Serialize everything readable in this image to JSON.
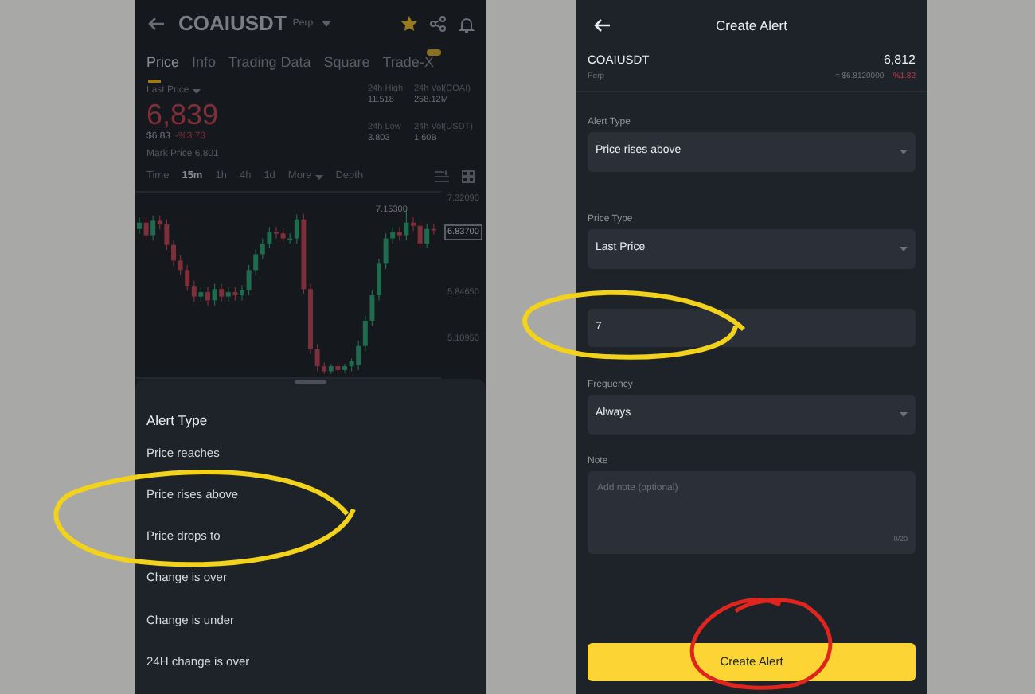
{
  "left_screen": {
    "header": {
      "symbol": "COAIUSDT",
      "contract": "Perp"
    },
    "tabs": [
      {
        "label": "Price",
        "selected": true
      },
      {
        "label": "Info",
        "selected": false
      },
      {
        "label": "Trading Data",
        "selected": false
      },
      {
        "label": "Square",
        "selected": false
      },
      {
        "label": "Trade-X",
        "selected": false
      }
    ],
    "ticker": {
      "price_label": "Last Price",
      "price": "6,839",
      "usd": "$6.83",
      "change": "-%3.73",
      "mark_price": "Mark Price 6.801"
    },
    "stats": [
      {
        "label": "24h High",
        "value": "11.518"
      },
      {
        "label": "24h Vol(COAI)",
        "value": "258.12M"
      },
      {
        "label": "24h Low",
        "value": "3.803"
      },
      {
        "label": "24h Vol(USDT)",
        "value": "1.60B"
      }
    ],
    "intervals": [
      {
        "label": "Time",
        "selected": false
      },
      {
        "label": "15m",
        "selected": true
      },
      {
        "label": "1h",
        "selected": false
      },
      {
        "label": "4h",
        "selected": false
      },
      {
        "label": "1d",
        "selected": false
      },
      {
        "label": "More",
        "selected": false
      },
      {
        "label": "Depth",
        "selected": false
      }
    ],
    "chart_data": {
      "type": "candlestick",
      "ohlc": [
        [
          6.85,
          7.03,
          6.77,
          6.95
        ],
        [
          6.95,
          7.03,
          6.67,
          6.75
        ],
        [
          6.75,
          7.06,
          6.67,
          6.98
        ],
        [
          6.98,
          7.06,
          6.84,
          6.92
        ],
        [
          6.92,
          7.0,
          6.52,
          6.6
        ],
        [
          6.6,
          6.68,
          6.27,
          6.35
        ],
        [
          6.35,
          6.43,
          6.12,
          6.2
        ],
        [
          6.2,
          6.28,
          5.87,
          5.95
        ],
        [
          5.95,
          6.03,
          5.7,
          5.78
        ],
        [
          5.78,
          5.93,
          5.7,
          5.85
        ],
        [
          5.85,
          5.93,
          5.64,
          5.72
        ],
        [
          5.72,
          5.98,
          5.64,
          5.9
        ],
        [
          5.9,
          5.98,
          5.7,
          5.78
        ],
        [
          5.78,
          5.93,
          5.7,
          5.85
        ],
        [
          5.85,
          5.93,
          5.72,
          5.8
        ],
        [
          5.8,
          5.96,
          5.72,
          5.88
        ],
        [
          5.88,
          6.28,
          5.8,
          6.2
        ],
        [
          6.2,
          6.53,
          6.12,
          6.45
        ],
        [
          6.45,
          6.7,
          6.37,
          6.62
        ],
        [
          6.62,
          6.88,
          6.54,
          6.8
        ],
        [
          6.8,
          6.88,
          6.7,
          6.78
        ],
        [
          6.78,
          6.86,
          6.62,
          6.7
        ],
        [
          6.7,
          6.78,
          6.62,
          6.7
        ],
        [
          6.7,
          7.08,
          6.62,
          7.0
        ],
        [
          7.0,
          7.08,
          5.82,
          5.9
        ],
        [
          5.9,
          5.98,
          4.87,
          4.95
        ],
        [
          4.95,
          5.03,
          4.6,
          4.68
        ],
        [
          4.68,
          4.74,
          4.56,
          4.6
        ],
        [
          4.6,
          4.72,
          4.56,
          4.68
        ],
        [
          4.68,
          4.74,
          4.58,
          4.62
        ],
        [
          4.62,
          4.72,
          4.57,
          4.68
        ],
        [
          4.68,
          4.8,
          4.6,
          4.76
        ],
        [
          4.7,
          5.08,
          4.62,
          5.0
        ],
        [
          5.0,
          5.48,
          4.92,
          5.4
        ],
        [
          5.4,
          5.88,
          5.32,
          5.8
        ],
        [
          5.8,
          6.38,
          5.72,
          6.3
        ],
        [
          6.3,
          6.78,
          6.22,
          6.7
        ],
        [
          6.7,
          6.88,
          6.62,
          6.8
        ],
        [
          6.8,
          6.88,
          6.67,
          6.75
        ],
        [
          6.75,
          7.153,
          6.67,
          6.95
        ],
        [
          6.95,
          7.03,
          6.82,
          6.9
        ],
        [
          6.9,
          6.98,
          6.54,
          6.62
        ],
        [
          6.62,
          6.93,
          6.54,
          6.85
        ],
        [
          6.85,
          6.93,
          6.76,
          6.84
        ]
      ],
      "yticks": [
        {
          "value": 7.3209,
          "label": "7.32090"
        },
        {
          "value": 5.8465,
          "label": "5.84650"
        },
        {
          "value": 5.1095,
          "label": "5.10950"
        }
      ],
      "ylim": [
        4.48,
        7.45
      ],
      "annotations": [
        "7.15300",
        "6.83700"
      ]
    },
    "alert_sheet": {
      "title": "Alert Type",
      "options": [
        "Price reaches",
        "Price rises above",
        "Price drops to",
        "Change is over",
        "Change is under",
        "24H change is over"
      ]
    }
  },
  "right_screen": {
    "title": "Create Alert",
    "symbol": "COAIUSDT",
    "contract": "Perp",
    "price": "6,812",
    "usd": "≈ $6.8120000",
    "change": "-%1.82",
    "alert_type": {
      "label": "Alert Type",
      "value": "Price rises above"
    },
    "price_type": {
      "label": "Price Type",
      "value": "Last Price"
    },
    "price_input": {
      "value": "7"
    },
    "frequency": {
      "label": "Frequency",
      "value": "Always"
    },
    "note": {
      "label": "Note",
      "placeholder": "Add note (optional)",
      "counter": "0/20"
    },
    "button": "Create Alert"
  }
}
